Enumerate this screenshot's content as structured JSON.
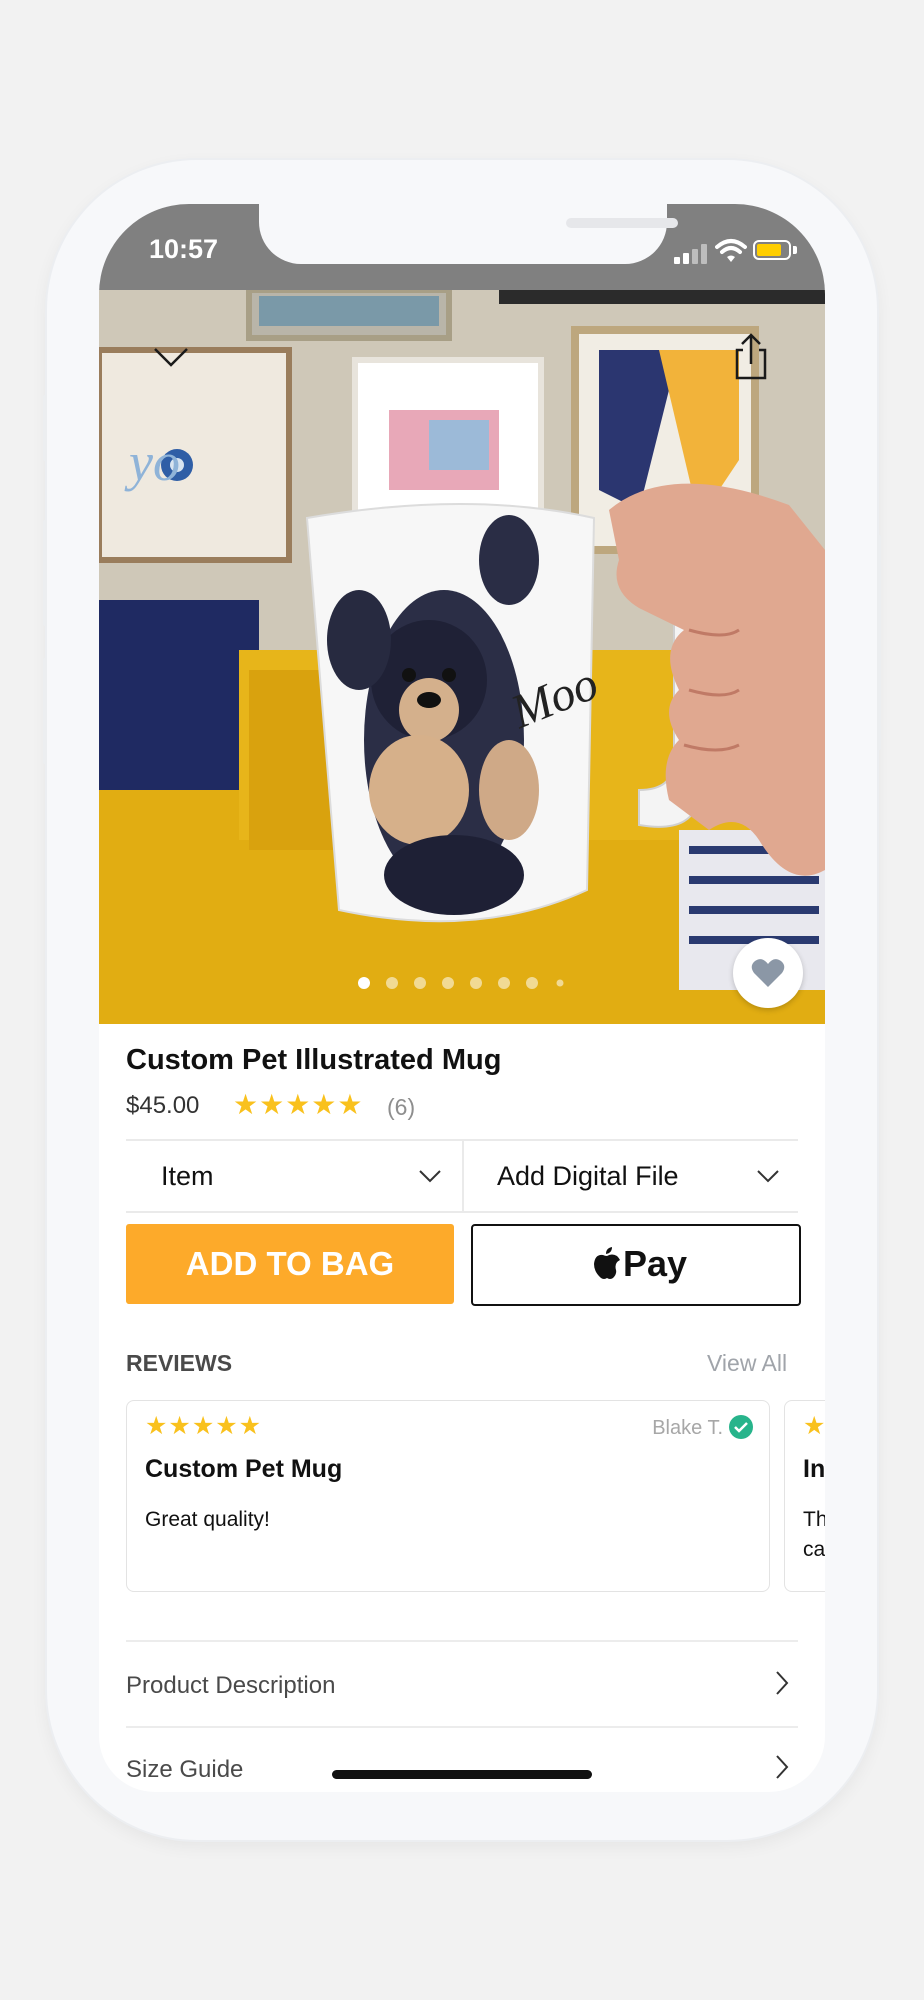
{
  "status_bar": {
    "time": "10:57"
  },
  "hero": {
    "image_alt": "Photo of a white mug with an illustrated black and tan dog signed Moo, held in front of a yellow sofa",
    "mug_signature": "Moo",
    "pager_count": 8,
    "pager_active_index": 0
  },
  "product": {
    "title": "Custom Pet Illustrated Mug",
    "price": "$45.00",
    "rating_stars": "★★★★★",
    "rating_count": "(6)"
  },
  "options": {
    "item_label": "Item",
    "digital_label": "Add Digital File"
  },
  "actions": {
    "add_to_bag": "ADD TO BAG",
    "apple_pay": "Pay"
  },
  "reviews": {
    "heading": "REVIEWS",
    "view_all": "View All",
    "cards": [
      {
        "stars": "★★★★★",
        "author": "Blake T.",
        "title": "Custom Pet Mug",
        "body": "Great quality!"
      },
      {
        "stars": "★",
        "title": "In",
        "body_line1": "Th",
        "body_line2": "ca"
      }
    ]
  },
  "sections": [
    {
      "label": "Product Description"
    },
    {
      "label": "Size Guide"
    }
  ],
  "colors": {
    "accent_orange": "#fdaa2a",
    "star_yellow": "#f9c11d",
    "verified_green": "#27b48b",
    "status_bar_gray": "#808080"
  }
}
